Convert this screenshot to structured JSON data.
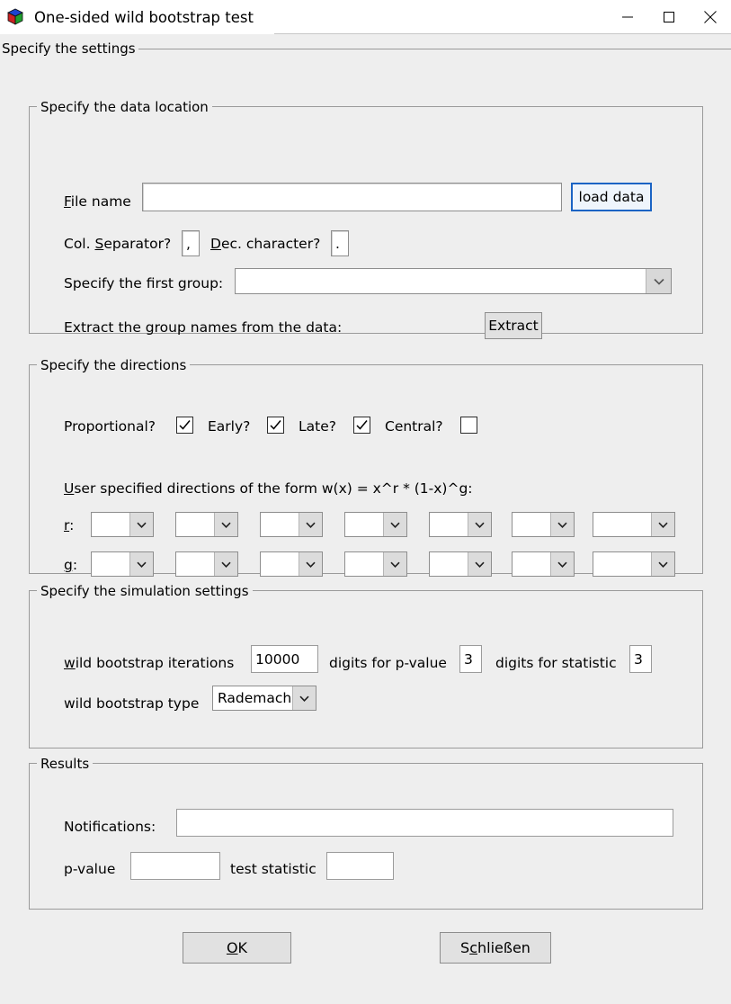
{
  "window": {
    "title": "One-sided wild bootstrap test",
    "app_icon": "matlab-cube-icon",
    "minimize_label": "—",
    "maximize_label": "□",
    "close_label": "✕"
  },
  "outer_group": {
    "legend": "Specify the settings"
  },
  "data_location": {
    "legend": "Specify the data location",
    "file_name_label": "File name",
    "file_name_value": "",
    "file_name_placeholder": "",
    "load_data_label": "load data",
    "col_separator_label": "Col. Separator?",
    "col_separator_value": ",",
    "dec_character_label": "Dec. character?",
    "dec_character_value": ".",
    "first_group_label": "Specify the first group:",
    "first_group_value": "",
    "extract_label_text": "Extract the group names from the data:",
    "extract_button_label": "Extract"
  },
  "directions": {
    "legend": "Specify the directions",
    "checkboxes": [
      {
        "label": "Proportional?",
        "checked": true
      },
      {
        "label": "Early?",
        "checked": true
      },
      {
        "label": "Late?",
        "checked": true
      },
      {
        "label": "Central?",
        "checked": false
      }
    ],
    "user_spec_label": "User specified directions of the form w(x) = x^r * (1-x)^g:",
    "r_label": "r:",
    "g_label": "g:",
    "r_values": [
      "",
      "",
      "",
      "",
      "",
      "",
      ""
    ],
    "g_values": [
      "",
      "",
      "",
      "",
      "",
      "",
      ""
    ]
  },
  "simulation": {
    "legend": "Specify the simulation settings",
    "iterations_label": "wild bootstrap iterations",
    "iterations_value": "10000",
    "digits_pvalue_label": "digits for p-value",
    "digits_pvalue_value": "3",
    "digits_statistic_label": "digits for statistic",
    "digits_statistic_value": "3",
    "type_label": "wild bootstrap type",
    "type_value": "Rademacher"
  },
  "results": {
    "legend": "Results",
    "notifications_label": "Notifications:",
    "notifications_value": "",
    "pvalue_label": "p-value",
    "pvalue_value": "",
    "statistic_label": "test statistic",
    "statistic_value": ""
  },
  "footer": {
    "ok_label_pre": "",
    "ok_label_accel": "O",
    "ok_label_post": "K",
    "close_label_pre": "S",
    "close_label_accel": "c",
    "close_label_post": "hließen"
  },
  "colors": {
    "window_bg": "#eeeeee",
    "titlebar_bg": "#ffffff",
    "frame_border": "#9a9a9a",
    "focus_blue": "#1b64c4",
    "button_face": "#e1e1e1",
    "field_bg": "#ffffff"
  }
}
